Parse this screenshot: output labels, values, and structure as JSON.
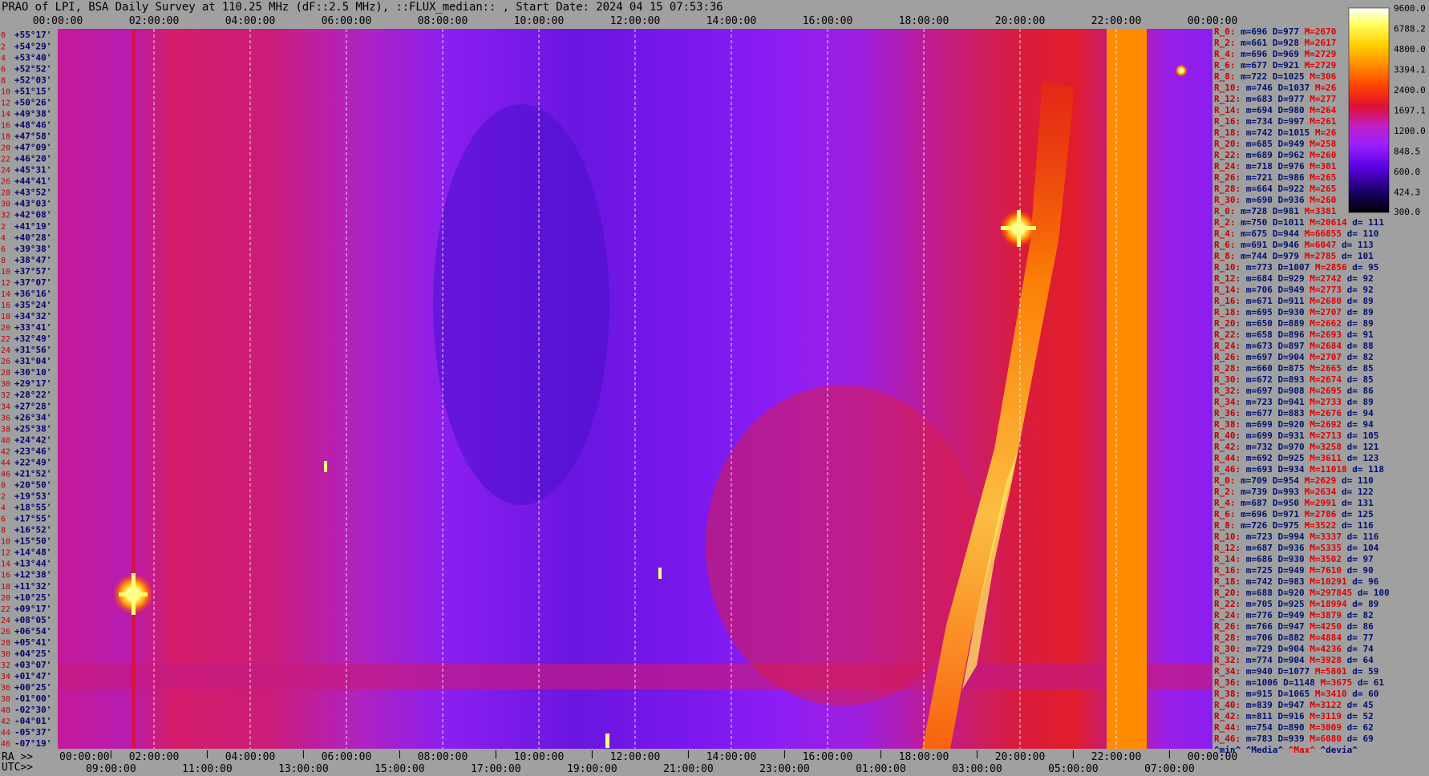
{
  "title": "PRAO of LPI, BSA Daily Survey at 110.25 MHz (dF::2.5 MHz), ::FLUX_median:: , Start Date: 2024 04 15 07:53:36",
  "chart_data": {
    "type": "heatmap",
    "top_axis_ticks": [
      "00:00:00",
      "02:00:00",
      "04:00:00",
      "06:00:00",
      "08:00:00",
      "10:00:00",
      "12:00:00",
      "14:00:00",
      "16:00:00",
      "18:00:00",
      "20:00:00",
      "22:00:00",
      "00:00:00"
    ],
    "ra_axis_label": "RA >>",
    "ra_axis_ticks": [
      "00:00:00",
      "02:00:00",
      "04:00:00",
      "06:00:00",
      "08:00:00",
      "10:00:00",
      "12:00:00",
      "14:00:00",
      "16:00:00",
      "18:00:00",
      "20:00:00",
      "22:00:00",
      "00:00:00"
    ],
    "utc_axis_label": "UTC>>",
    "utc_axis_ticks": [
      "09:00:00",
      "11:00:00",
      "13:00:00",
      "15:00:00",
      "17:00:00",
      "19:00:00",
      "21:00:00",
      "23:00:00",
      "01:00:00",
      "03:00:00",
      "05:00:00",
      "07:00:00"
    ],
    "beam_labels": [
      {
        "n": "0",
        "dec": "+55°17'"
      },
      {
        "n": "2",
        "dec": "+54°29'"
      },
      {
        "n": "4",
        "dec": "+53°40'"
      },
      {
        "n": "6",
        "dec": "+52°52'"
      },
      {
        "n": "8",
        "dec": "+52°03'"
      },
      {
        "n": "10",
        "dec": "+51°15'"
      },
      {
        "n": "12",
        "dec": "+50°26'"
      },
      {
        "n": "14",
        "dec": "+49°38'"
      },
      {
        "n": "16",
        "dec": "+48°46'"
      },
      {
        "n": "18",
        "dec": "+47°58'"
      },
      {
        "n": "20",
        "dec": "+47°09'"
      },
      {
        "n": "22",
        "dec": "+46°20'"
      },
      {
        "n": "24",
        "dec": "+45°31'"
      },
      {
        "n": "26",
        "dec": "+44°41'"
      },
      {
        "n": "28",
        "dec": "+43°52'"
      },
      {
        "n": "30",
        "dec": "+43°03'"
      },
      {
        "n": "32",
        "dec": "+42°08'"
      },
      {
        "n": "2",
        "dec": "+41°19'"
      },
      {
        "n": "4",
        "dec": "+40°28'"
      },
      {
        "n": "6",
        "dec": "+39°38'"
      },
      {
        "n": "8",
        "dec": "+38°47'"
      },
      {
        "n": "10",
        "dec": "+37°57'"
      },
      {
        "n": "12",
        "dec": "+37°07'"
      },
      {
        "n": "14",
        "dec": "+36°16'"
      },
      {
        "n": "16",
        "dec": "+35°24'"
      },
      {
        "n": "18",
        "dec": "+34°32'"
      },
      {
        "n": "20",
        "dec": "+33°41'"
      },
      {
        "n": "22",
        "dec": "+32°49'"
      },
      {
        "n": "24",
        "dec": "+31°56'"
      },
      {
        "n": "26",
        "dec": "+31°04'"
      },
      {
        "n": "28",
        "dec": "+30°10'"
      },
      {
        "n": "30",
        "dec": "+29°17'"
      },
      {
        "n": "32",
        "dec": "+28°22'"
      },
      {
        "n": "34",
        "dec": "+27°28'"
      },
      {
        "n": "36",
        "dec": "+26°34'"
      },
      {
        "n": "38",
        "dec": "+25°38'"
      },
      {
        "n": "40",
        "dec": "+24°42'"
      },
      {
        "n": "42",
        "dec": "+23°46'"
      },
      {
        "n": "44",
        "dec": "+22°49'"
      },
      {
        "n": "46",
        "dec": "+21°52'"
      },
      {
        "n": "0",
        "dec": "+20°50'"
      },
      {
        "n": "2",
        "dec": "+19°53'"
      },
      {
        "n": "4",
        "dec": "+18°55'"
      },
      {
        "n": "6",
        "dec": "+17°55'"
      },
      {
        "n": "8",
        "dec": "+16°52'"
      },
      {
        "n": "10",
        "dec": "+15°50'"
      },
      {
        "n": "12",
        "dec": "+14°48'"
      },
      {
        "n": "14",
        "dec": "+13°44'"
      },
      {
        "n": "16",
        "dec": "+12°38'"
      },
      {
        "n": "18",
        "dec": "+11°32'"
      },
      {
        "n": "20",
        "dec": "+10°25'"
      },
      {
        "n": "22",
        "dec": "+09°17'"
      },
      {
        "n": "24",
        "dec": "+08°05'"
      },
      {
        "n": "26",
        "dec": "+06°54'"
      },
      {
        "n": "28",
        "dec": "+05°41'"
      },
      {
        "n": "30",
        "dec": "+04°25'"
      },
      {
        "n": "32",
        "dec": "+03°07'"
      },
      {
        "n": "34",
        "dec": "+01°47'"
      },
      {
        "n": "36",
        "dec": "+00°25'"
      },
      {
        "n": "38",
        "dec": "-01°00'"
      },
      {
        "n": "40",
        "dec": "-02°30'"
      },
      {
        "n": "42",
        "dec": "-04°01'"
      },
      {
        "n": "44",
        "dec": "-05°37'"
      },
      {
        "n": "46",
        "dec": "-07°19'"
      }
    ],
    "colorbar_ticks": [
      "9600.0",
      "6788.2",
      "4800.0",
      "3394.1",
      "2400.0",
      "1697.1",
      "1200.0",
      "848.5",
      "600.0",
      "424.3",
      "300.0"
    ],
    "colorbar_range": [
      300,
      9600
    ],
    "colorbar_scale": "log",
    "colormap_stops": [
      "#000000",
      "#1a0066",
      "#5a00e0",
      "#9a20ff",
      "#c020c8",
      "#e01030",
      "#ff4400",
      "#ff8c00",
      "#ffd000",
      "#ffff60",
      "#ffffff"
    ],
    "stats_rows": [
      {
        "r": "R_0:",
        "m": "696",
        "D": "977",
        "M": "2670",
        "d": ""
      },
      {
        "r": "R_2:",
        "m": "661",
        "D": "928",
        "M": "2617",
        "d": ""
      },
      {
        "r": "R_4:",
        "m": "696",
        "D": "969",
        "M": "2729",
        "d": ""
      },
      {
        "r": "R_6:",
        "m": "677",
        "D": "921",
        "M": "2729",
        "d": ""
      },
      {
        "r": "R_8:",
        "m": "722",
        "D": "1025",
        "M": "306",
        "d": ""
      },
      {
        "r": "R_10:",
        "m": "746",
        "D": "1037",
        "M": "26",
        "d": ""
      },
      {
        "r": "R_12:",
        "m": "683",
        "D": "977",
        "M": "277",
        "d": ""
      },
      {
        "r": "R_14:",
        "m": "694",
        "D": "980",
        "M": "264",
        "d": ""
      },
      {
        "r": "R_16:",
        "m": "734",
        "D": "997",
        "M": "261",
        "d": ""
      },
      {
        "r": "R_18:",
        "m": "742",
        "D": "1015",
        "M": "26",
        "d": ""
      },
      {
        "r": "R_20:",
        "m": "685",
        "D": "949",
        "M": "258",
        "d": ""
      },
      {
        "r": "R_22:",
        "m": "689",
        "D": "962",
        "M": "260",
        "d": ""
      },
      {
        "r": "R_24:",
        "m": "718",
        "D": "976",
        "M": "301",
        "d": ""
      },
      {
        "r": "R_26:",
        "m": "721",
        "D": "986",
        "M": "265",
        "d": ""
      },
      {
        "r": "R_28:",
        "m": "664",
        "D": "922",
        "M": "265",
        "d": ""
      },
      {
        "r": "R_30:",
        "m": "690",
        "D": "936",
        "M": "260",
        "d": ""
      },
      {
        "r": "R_0:",
        "m": "728",
        "D": "981",
        "M": "3381",
        "d": ""
      },
      {
        "r": "R_2:",
        "m": "750",
        "D": "1011",
        "M": "20614",
        "d": "111"
      },
      {
        "r": "R_4:",
        "m": "675",
        "D": "944",
        "M": "66855",
        "d": "110"
      },
      {
        "r": "R_6:",
        "m": "691",
        "D": "946",
        "M": "6047",
        "d": "113"
      },
      {
        "r": "R_8:",
        "m": "744",
        "D": "979",
        "M": "2785",
        "d": "101"
      },
      {
        "r": "R_10:",
        "m": "773",
        "D": "1007",
        "M": "2856",
        "d": "95"
      },
      {
        "r": "R_12:",
        "m": "684",
        "D": "929",
        "M": "2742",
        "d": "92"
      },
      {
        "r": "R_14:",
        "m": "706",
        "D": "949",
        "M": "2773",
        "d": "92"
      },
      {
        "r": "R_16:",
        "m": "671",
        "D": "911",
        "M": "2680",
        "d": "89"
      },
      {
        "r": "R_18:",
        "m": "695",
        "D": "930",
        "M": "2707",
        "d": "89"
      },
      {
        "r": "R_20:",
        "m": "650",
        "D": "889",
        "M": "2662",
        "d": "89"
      },
      {
        "r": "R_22:",
        "m": "658",
        "D": "896",
        "M": "2693",
        "d": "91"
      },
      {
        "r": "R_24:",
        "m": "673",
        "D": "897",
        "M": "2684",
        "d": "88"
      },
      {
        "r": "R_26:",
        "m": "697",
        "D": "904",
        "M": "2707",
        "d": "82"
      },
      {
        "r": "R_28:",
        "m": "660",
        "D": "875",
        "M": "2665",
        "d": "85"
      },
      {
        "r": "R_30:",
        "m": "672",
        "D": "893",
        "M": "2674",
        "d": "85"
      },
      {
        "r": "R_32:",
        "m": "697",
        "D": "908",
        "M": "2695",
        "d": "86"
      },
      {
        "r": "R_34:",
        "m": "723",
        "D": "941",
        "M": "2733",
        "d": "89"
      },
      {
        "r": "R_36:",
        "m": "677",
        "D": "883",
        "M": "2676",
        "d": "94"
      },
      {
        "r": "R_38:",
        "m": "699",
        "D": "920",
        "M": "2692",
        "d": "94"
      },
      {
        "r": "R_40:",
        "m": "699",
        "D": "931",
        "M": "2713",
        "d": "105"
      },
      {
        "r": "R_42:",
        "m": "732",
        "D": "970",
        "M": "3258",
        "d": "121"
      },
      {
        "r": "R_44:",
        "m": "692",
        "D": "925",
        "M": "3611",
        "d": "123"
      },
      {
        "r": "R_46:",
        "m": "693",
        "D": "934",
        "M": "11018",
        "d": "118"
      },
      {
        "r": "R_0:",
        "m": "709",
        "D": "954",
        "M": "2629",
        "d": "110"
      },
      {
        "r": "R_2:",
        "m": "739",
        "D": "993",
        "M": "2634",
        "d": "122"
      },
      {
        "r": "R_4:",
        "m": "687",
        "D": "950",
        "M": "2991",
        "d": "131"
      },
      {
        "r": "R_6:",
        "m": "696",
        "D": "971",
        "M": "2786",
        "d": "125"
      },
      {
        "r": "R_8:",
        "m": "726",
        "D": "975",
        "M": "3522",
        "d": "116"
      },
      {
        "r": "R_10:",
        "m": "723",
        "D": "994",
        "M": "3337",
        "d": "116"
      },
      {
        "r": "R_12:",
        "m": "687",
        "D": "936",
        "M": "5335",
        "d": "104"
      },
      {
        "r": "R_14:",
        "m": "686",
        "D": "930",
        "M": "3502",
        "d": "97"
      },
      {
        "r": "R_16:",
        "m": "725",
        "D": "949",
        "M": "7610",
        "d": "90"
      },
      {
        "r": "R_18:",
        "m": "742",
        "D": "983",
        "M": "10291",
        "d": "96"
      },
      {
        "r": "R_20:",
        "m": "688",
        "D": "920",
        "M": "297845",
        "d": "100"
      },
      {
        "r": "R_22:",
        "m": "705",
        "D": "925",
        "M": "18994",
        "d": "89"
      },
      {
        "r": "R_24:",
        "m": "776",
        "D": "949",
        "M": "3879",
        "d": "82"
      },
      {
        "r": "R_26:",
        "m": "766",
        "D": "947",
        "M": "4250",
        "d": "86"
      },
      {
        "r": "R_28:",
        "m": "706",
        "D": "882",
        "M": "4884",
        "d": "77"
      },
      {
        "r": "R_30:",
        "m": "729",
        "D": "904",
        "M": "4236",
        "d": "74"
      },
      {
        "r": "R_32:",
        "m": "774",
        "D": "904",
        "M": "3928",
        "d": "64"
      },
      {
        "r": "R_34:",
        "m": "940",
        "D": "1077",
        "M": "5801",
        "d": "59"
      },
      {
        "r": "R_36:",
        "m": "1006",
        "D": "1148",
        "M": "3675",
        "d": "61"
      },
      {
        "r": "R_38:",
        "m": "915",
        "D": "1065",
        "M": "3410",
        "d": "60"
      },
      {
        "r": "R_40:",
        "m": "839",
        "D": "947",
        "M": "3122",
        "d": "45"
      },
      {
        "r": "R_42:",
        "m": "811",
        "D": "916",
        "M": "3119",
        "d": "52"
      },
      {
        "r": "R_44:",
        "m": "754",
        "D": "890",
        "M": "3009",
        "d": "62"
      },
      {
        "r": "R_46:",
        "m": "783",
        "D": "939",
        "M": "6080",
        "d": "69"
      }
    ],
    "stats_legend": {
      "min": "^min^",
      "median": "^Media^",
      "max": "^Max^",
      "dev": "^devia^"
    }
  }
}
